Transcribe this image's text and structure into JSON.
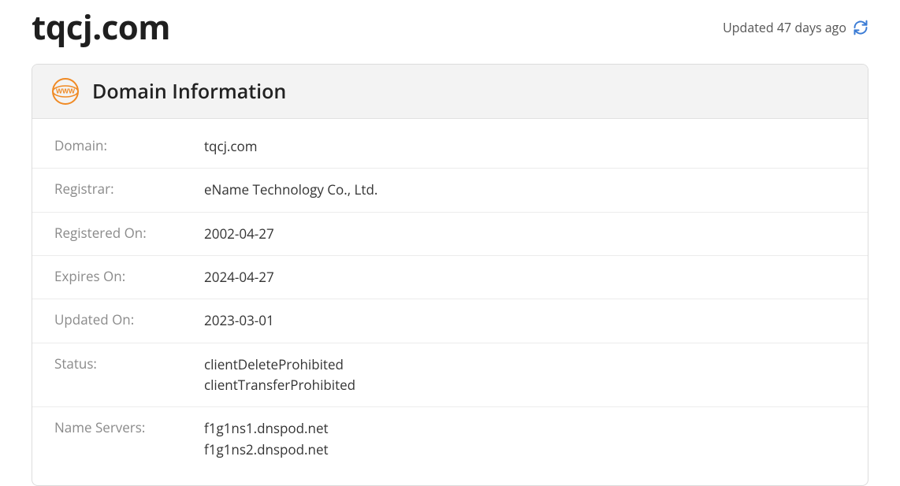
{
  "header": {
    "domain_title": "tqcj.com",
    "updated_text": "Updated 47 days ago"
  },
  "card": {
    "title": "Domain Information"
  },
  "rows": {
    "domain": {
      "label": "Domain:",
      "value": "tqcj.com"
    },
    "registrar": {
      "label": "Registrar:",
      "value": "eName Technology Co., Ltd."
    },
    "registered_on": {
      "label": "Registered On:",
      "value": "2002-04-27"
    },
    "expires_on": {
      "label": "Expires On:",
      "value": "2024-04-27"
    },
    "updated_on": {
      "label": "Updated On:",
      "value": "2023-03-01"
    },
    "status": {
      "label": "Status:",
      "value": "clientDeleteProhibited\nclientTransferProhibited"
    },
    "name_servers": {
      "label": "Name Servers:",
      "value": "f1g1ns1.dnspod.net\nf1g1ns2.dnspod.net"
    }
  }
}
